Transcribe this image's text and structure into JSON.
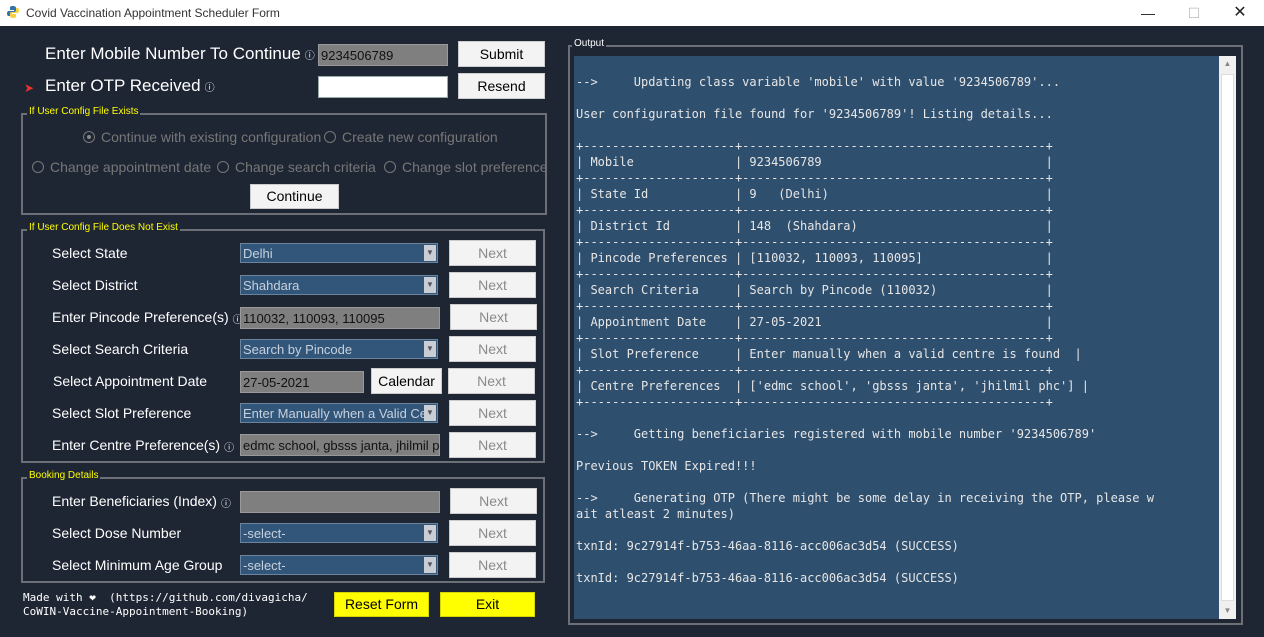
{
  "window": {
    "title": "Covid Vaccination Appointment Scheduler Form"
  },
  "top": {
    "mobile_label": "Enter Mobile Number To Continue",
    "mobile_value": "9234506789",
    "submit_label": "Submit",
    "otp_label": "Enter OTP Received",
    "otp_value": "",
    "resend_label": "Resend",
    "info_glyph": "ⓘ"
  },
  "config_exists": {
    "title": "If User Config File Exists",
    "options": [
      "Continue with existing configuration",
      "Create new configuration",
      "Change appointment date",
      "Change search criteria",
      "Change slot preference"
    ],
    "continue_label": "Continue"
  },
  "config_new": {
    "title": "If User Config File Does Not Exist",
    "rows": [
      {
        "label": "Select State",
        "value": "Delhi",
        "button": "Next"
      },
      {
        "label": "Select District",
        "value": "Shahdara",
        "button": "Next"
      },
      {
        "label": "Enter Pincode Preference(s)",
        "value": "110032, 110093, 110095",
        "button": "Next"
      },
      {
        "label": "Select Search Criteria",
        "value": "Search by Pincode",
        "button": "Next"
      },
      {
        "label": "Select Appointment Date",
        "value": "27-05-2021",
        "button": "Next"
      },
      {
        "label": "Select Slot Preference",
        "value": "Enter Manually when a Valid Ce",
        "button": "Next"
      },
      {
        "label": "Enter Centre Preference(s)",
        "value": "edmc school, gbsss janta, jhilmil p",
        "button": "Next"
      }
    ],
    "calendar_label": "Calendar"
  },
  "booking": {
    "title": "Booking Details",
    "rows": [
      {
        "label": "Enter Beneficiaries (Index)",
        "value": "",
        "button": "Next"
      },
      {
        "label": "Select Dose Number",
        "value": "-select-",
        "button": "Next"
      },
      {
        "label": "Select Minimum Age Group",
        "value": "-select-",
        "button": "Next"
      }
    ]
  },
  "footer": {
    "made_with": "Made with ❤  (https://github.com/divagicha/\nCoWIN-Vaccine-Appointment-Booking)",
    "reset_label": "Reset Form",
    "exit_label": "Exit"
  },
  "output": {
    "title": "Output",
    "text": "\n-->     Updating class variable 'mobile' with value '9234506789'...\n\nUser configuration file found for '9234506789'! Listing details...\n\n+---------------------+------------------------------------------+\n| Mobile              | 9234506789                               |\n+---------------------+------------------------------------------+\n| State Id            | 9   (Delhi)                              |\n+---------------------+------------------------------------------+\n| District Id         | 148  (Shahdara)                          |\n+---------------------+------------------------------------------+\n| Pincode Preferences | [110032, 110093, 110095]                 |\n+---------------------+------------------------------------------+\n| Search Criteria     | Search by Pincode (110032)               |\n+---------------------+------------------------------------------+\n| Appointment Date    | 27-05-2021                               |\n+---------------------+------------------------------------------+\n| Slot Preference     | Enter manually when a valid centre is found  |\n+---------------------+------------------------------------------+\n| Centre Preferences  | ['edmc school', 'gbsss janta', 'jhilmil phc'] |\n+---------------------+------------------------------------------+\n\n-->     Getting beneficiaries registered with mobile number '9234506789'\n\nPrevious TOKEN Expired!!!\n\n-->     Generating OTP (There might be some delay in receiving the OTP, please w\nait atleast 2 minutes)\n\ntxnId: 9c27914f-b753-46aa-8116-acc006ac3d54 (SUCCESS)\n\ntxnId: 9c27914f-b753-46aa-8116-acc006ac3d54 (SUCCESS)"
  }
}
